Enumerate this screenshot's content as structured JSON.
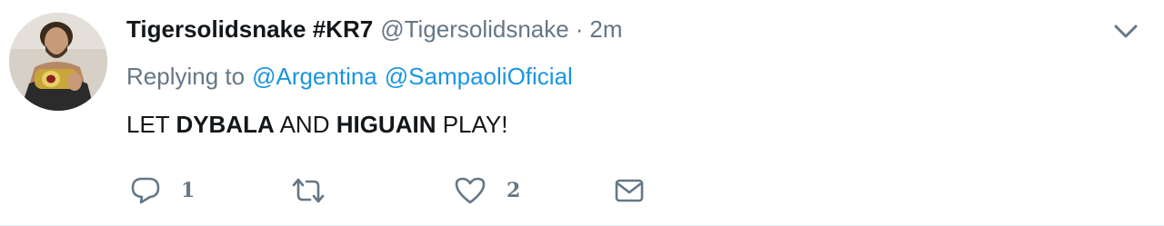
{
  "tweet": {
    "display_name": "Tigersolidsnake #KR7",
    "handle": "@Tigersolidsnake",
    "separator": "·",
    "time": "2m",
    "replying_to_label": "Replying to",
    "mentions": [
      "@Argentina",
      "@SampaoliOficial"
    ],
    "text_parts": [
      "LET ",
      "DYBALA",
      " AND ",
      "HIGUAIN",
      " PLAY!"
    ]
  },
  "actions": {
    "reply_icon": "reply-bubble-icon",
    "reply_count": "1",
    "retweet_icon": "retweet-icon",
    "like_icon": "heart-icon",
    "like_count": "2",
    "dm_icon": "envelope-icon"
  },
  "colors": {
    "text": "#14171a",
    "muted": "#657786",
    "link": "#1b95e0",
    "border": "#e6ecf0"
  }
}
